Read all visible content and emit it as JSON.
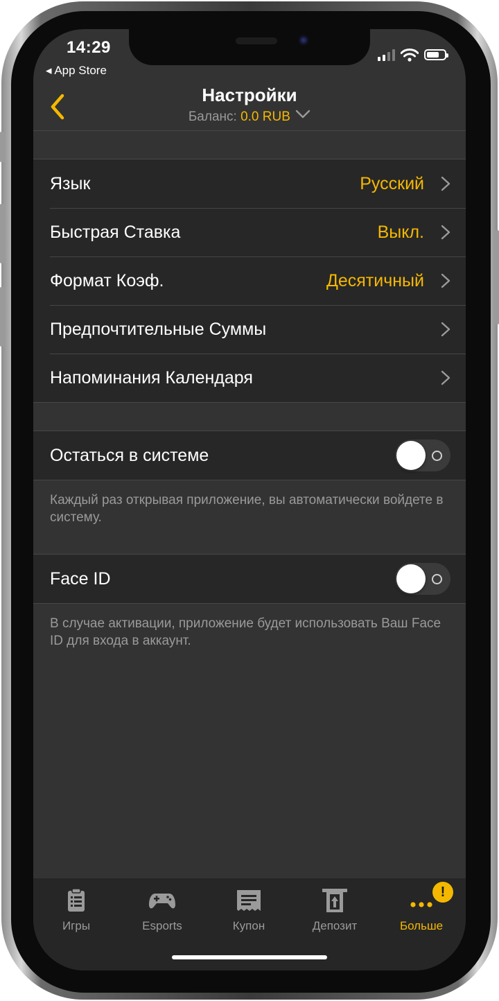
{
  "status_bar": {
    "time": "14:29",
    "back_app": "◂ App Store"
  },
  "header": {
    "title": "Настройки",
    "balance_label": "Баланс:",
    "balance_value": "0.0 RUB"
  },
  "settings": [
    {
      "label": "Язык",
      "value": "Русский"
    },
    {
      "label": "Быстрая Ставка",
      "value": "Выкл."
    },
    {
      "label": "Формат Коэф.",
      "value": "Десятичный"
    },
    {
      "label": "Предпочтительные Суммы",
      "value": ""
    },
    {
      "label": "Напоминания Календаря",
      "value": ""
    }
  ],
  "stay_signed_in": {
    "label": "Остаться в системе",
    "enabled": false,
    "note": "Каждый раз открывая приложение, вы автоматически войдете в систему."
  },
  "face_id": {
    "label": "Face ID",
    "enabled": false,
    "note": "В случае активации, приложение будет использовать Ваш Face ID для входа в аккаунт."
  },
  "tabbar": {
    "items": [
      {
        "label": "Игры",
        "icon": "clipboard-icon",
        "active": false
      },
      {
        "label": "Esports",
        "icon": "gamepad-icon",
        "active": false
      },
      {
        "label": "Купон",
        "icon": "receipt-icon",
        "active": false
      },
      {
        "label": "Депозит",
        "icon": "deposit-icon",
        "active": false
      },
      {
        "label": "Больше",
        "icon": "more-dots-icon",
        "active": true,
        "badge": "!"
      }
    ]
  },
  "colors": {
    "accent": "#f5b800",
    "background": "#333333",
    "cell": "#272727",
    "text": "#ffffff",
    "secondary_text": "#9a9a9a"
  }
}
